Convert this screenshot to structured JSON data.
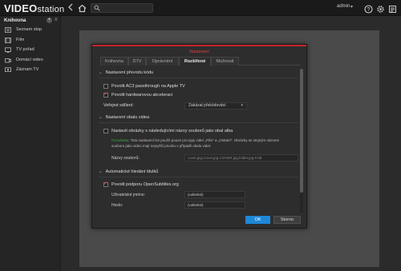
{
  "app": {
    "logo_prefix": "VIDEO",
    "logo_suffix": "station"
  },
  "topbar": {
    "user": "admin",
    "user_caret": "▾"
  },
  "sidebar": {
    "header": "Knihovna",
    "add_symbol": "+",
    "menu_symbol": "≡",
    "items": [
      {
        "label": "Seznam stop",
        "icon": "playlist-icon"
      },
      {
        "label": "Film",
        "icon": "film-icon"
      },
      {
        "label": "TV pořad",
        "icon": "tv-icon"
      },
      {
        "label": "Domácí video",
        "icon": "home-video-icon"
      },
      {
        "label": "Záznam TV",
        "icon": "tv-recording-icon"
      }
    ]
  },
  "dialog": {
    "title": "Nastavení",
    "tabs": [
      {
        "label": "Knihovna",
        "active": false
      },
      {
        "label": "DTV",
        "active": false
      },
      {
        "label": "Oprávnění",
        "active": false
      },
      {
        "label": "Rozšířené",
        "active": true
      },
      {
        "label": "Možnosti",
        "active": false
      }
    ],
    "sections": {
      "transcoding": {
        "title": "Nastavení převodu kódu",
        "ac3_label": "Povolit AC3 passthrough na Apple TV",
        "ac3_checked": false,
        "hwaccel_label": "Povolit hardwarovou akceleraci",
        "hwaccel_checked": true,
        "default_label": "Veřejné sdílení:",
        "default_value": "Zakázat překódování"
      },
      "cover": {
        "title": "Nastavení obalu videa",
        "option_label": "Nastavit obrázky s následujícími názvy souborů jako obal alba",
        "option_checked": false,
        "note_key": "Poznámka:",
        "note_line1": "Toto nastavení lze použít pouze pro typy videí „Film“ a „Ostatní“. Obrázky se stejným názvem",
        "note_line2": "souboru jako video mají nejvyšší prioritu v případě obalu videí.",
        "filenames_label": "Názvy souborů:",
        "filenames_value": "cover.jpg,Cover.jpg,COVER.jpg,folder.jpg,Fold"
      },
      "subtitles": {
        "title": "Automatické hledání titulků",
        "option_label": "Povolit podporu OpenSubtitles.org",
        "option_checked": true,
        "username_label": "Uživatelské jméno:",
        "username_placeholder": "(volitelné)",
        "password_label": "Heslo:",
        "password_placeholder": "(volitelné)"
      }
    },
    "ok_label": "OK",
    "cancel_label": "Storno"
  },
  "colors": {
    "accent_red": "#c8262c",
    "primary_blue": "#1e88d8",
    "note_green": "#3fae4a"
  }
}
